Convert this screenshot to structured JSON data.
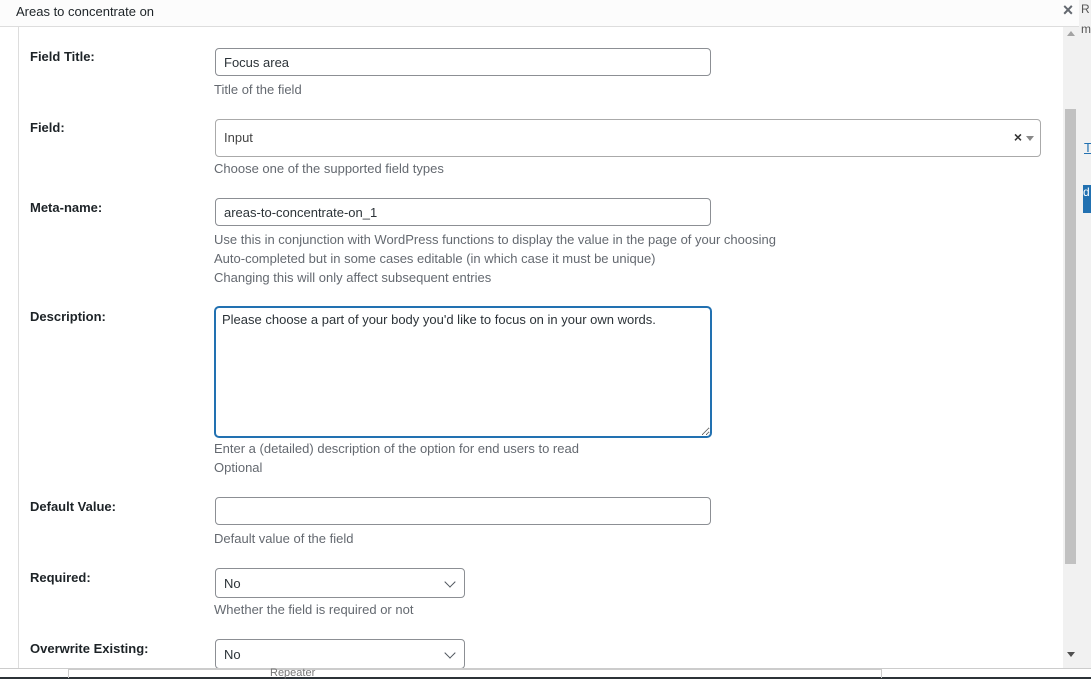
{
  "background": {
    "right_text_1": "R",
    "right_text_2": "m",
    "right_link": "T",
    "right_button": "d",
    "bottom_select": "Repeater"
  },
  "modal": {
    "title": "Areas to concentrate on",
    "close_glyph": "×"
  },
  "fields": {
    "title": {
      "label": "Field Title:",
      "value": "Focus area",
      "help": "Title of the field"
    },
    "field": {
      "label": "Field:",
      "value": "Input",
      "clear_glyph": "×",
      "help": "Choose one of the supported field types"
    },
    "meta": {
      "label": "Meta-name:",
      "value": "areas-to-concentrate-on_1",
      "help_1": "Use this in conjunction with WordPress functions to display the value in the page of your choosing",
      "help_2": "Auto-completed but in some cases editable (in which case it must be unique)",
      "help_3": "Changing this will only affect subsequent entries"
    },
    "description": {
      "label": "Description:",
      "value": "Please choose a part of your body you'd like to focus on in your own words.",
      "help_1": "Enter a (detailed) description of the option for end users to read",
      "help_2": "Optional"
    },
    "default": {
      "label": "Default Value:",
      "value": "",
      "help": "Default value of the field"
    },
    "required": {
      "label": "Required:",
      "value": "No",
      "help": "Whether the field is required or not"
    },
    "overwrite": {
      "label": "Overwrite Existing:",
      "value": "No"
    }
  }
}
